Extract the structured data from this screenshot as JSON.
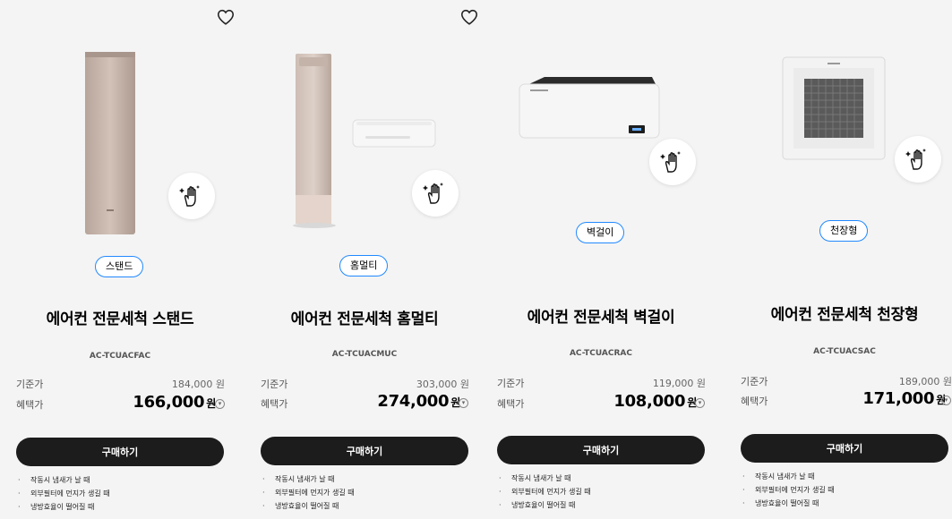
{
  "products": [
    {
      "type_label": "스탠드",
      "title": "에어컨 전문세척 스탠드",
      "model": "AC-TCUACFAC",
      "regular_label": "기준가",
      "regular_price": "184,000 원",
      "benefit_label": "혜택가",
      "benefit_price": "166,000",
      "currency": "원",
      "buy_label": "구매하기",
      "notes": [
        "작동시 냄새가 날 때",
        "외부필터에 먼지가 생길 때",
        "냉방효율이 떨어질 때"
      ],
      "icons": {
        "wishlist": "heart-icon",
        "cleaning": "cleaning-hand-icon",
        "info": "chevron-down-icon"
      }
    },
    {
      "type_label": "홈멀티",
      "title": "에어컨 전문세척 홈멀티",
      "model": "AC-TCUACMUC",
      "regular_label": "기준가",
      "regular_price": "303,000 원",
      "benefit_label": "혜택가",
      "benefit_price": "274,000",
      "currency": "원",
      "buy_label": "구매하기",
      "notes": [
        "작동시 냄새가 날 때",
        "외부필터에 먼지가 생길 때",
        "냉방효율이 떨어질 때"
      ],
      "icons": {
        "wishlist": "heart-icon",
        "cleaning": "cleaning-hand-icon",
        "info": "chevron-down-icon"
      }
    },
    {
      "type_label": "벽걸이",
      "title": "에어컨 전문세척 벽걸이",
      "model": "AC-TCUACRAC",
      "regular_label": "기준가",
      "regular_price": "119,000 원",
      "benefit_label": "혜택가",
      "benefit_price": "108,000",
      "currency": "원",
      "buy_label": "구매하기",
      "notes": [
        "작동시 냄새가 날 때",
        "외부필터에 먼지가 생길 때",
        "냉방효율이 떨어질 때"
      ],
      "icons": {
        "cleaning": "cleaning-hand-icon",
        "info": "chevron-down-icon"
      }
    },
    {
      "type_label": "천장형",
      "title": "에어컨 전문세척 천장형",
      "model": "AC-TCUACSAC",
      "regular_label": "기준가",
      "regular_price": "189,000 원",
      "benefit_label": "혜택가",
      "benefit_price": "171,000",
      "currency": "원",
      "buy_label": "구매하기",
      "notes": [
        "작동시 냄새가 날 때",
        "외부필터에 먼지가 생길 때",
        "냉방효율이 떨어질 때"
      ],
      "icons": {
        "cleaning": "cleaning-hand-icon",
        "info": "chevron-down-icon"
      }
    }
  ],
  "colors": {
    "background": "#f4f4f4",
    "button": "#1c1c1c",
    "chip_border": "#2189ff"
  }
}
